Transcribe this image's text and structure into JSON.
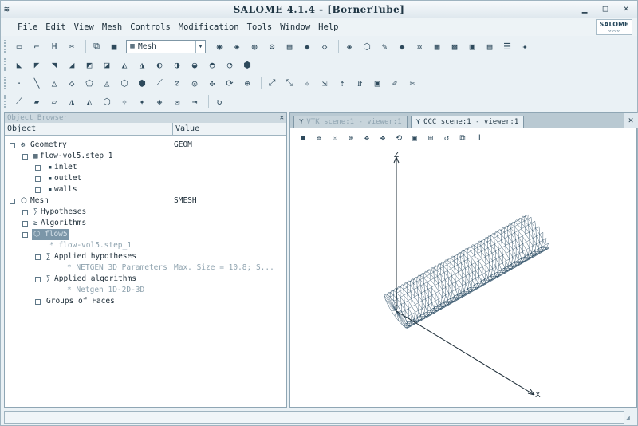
{
  "window": {
    "title": "SALOME 4.1.4 - [BornerTube]",
    "controls": [
      "minimize-icon",
      "maximize-icon",
      "close-icon"
    ]
  },
  "menu": [
    "File",
    "Edit",
    "View",
    "Mesh",
    "Controls",
    "Modification",
    "Tools",
    "Window",
    "Help"
  ],
  "logo": "SALOME",
  "toolbar": {
    "module_selector": {
      "value": "Mesh"
    }
  },
  "object_browser": {
    "title": "Object Browser",
    "columns": [
      "Object",
      "Value"
    ],
    "rows": [
      {
        "label": "Geometry",
        "value": "GEOM"
      },
      {
        "label": "flow-vol5.step_1",
        "value": ""
      },
      {
        "label": "inlet",
        "value": ""
      },
      {
        "label": "outlet",
        "value": ""
      },
      {
        "label": "walls",
        "value": ""
      },
      {
        "label": "Mesh",
        "value": "SMESH"
      },
      {
        "label": "Hypotheses",
        "value": ""
      },
      {
        "label": "Algorithms",
        "value": ""
      },
      {
        "label": "flow5",
        "value": ""
      },
      {
        "label": "* flow-vol5.step_1",
        "value": ""
      },
      {
        "label": "Applied hypotheses",
        "value": ""
      },
      {
        "label": "* NETGEN 3D Parameters",
        "value": "Max. Size = 10.8; S..."
      },
      {
        "label": "Applied algorithms",
        "value": ""
      },
      {
        "label": "* Netgen 1D-2D-3D",
        "value": ""
      },
      {
        "label": "Groups of Faces",
        "value": ""
      }
    ]
  },
  "viewer": {
    "tabs": [
      "VTK scene:1 - viewer:1",
      "OCC scene:1 - viewer:1"
    ],
    "active_tab": 1,
    "axes": {
      "z": "Z",
      "x": "X"
    }
  },
  "colors": {
    "mesh": "#2f4f66",
    "selection": "#7b96a8",
    "background": "#eaf1f5"
  }
}
